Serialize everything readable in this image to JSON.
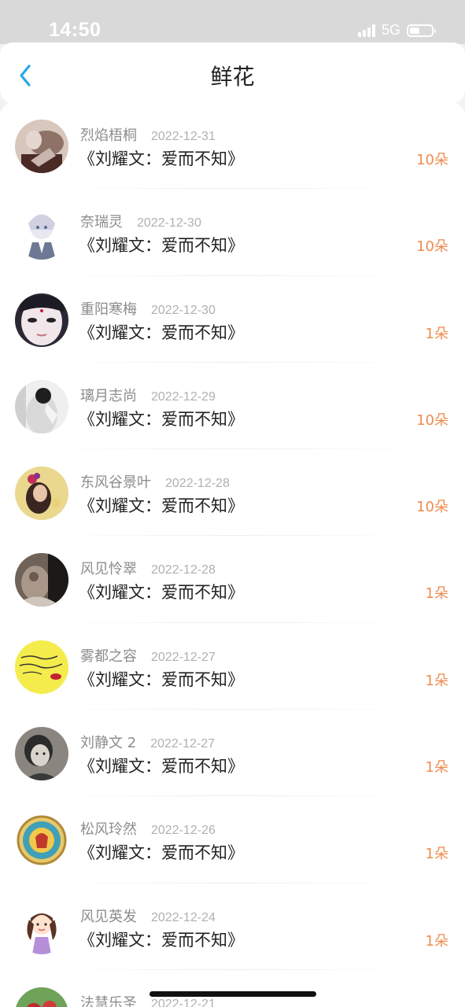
{
  "status_bar": {
    "time": "14:50",
    "network": "5G",
    "battery_level": 0.45
  },
  "header": {
    "back_icon": "chevron-left-icon",
    "title": "鲜花"
  },
  "colors": {
    "accent": "#2aa7e8",
    "count": "#ef8b4f",
    "name": "#8c8c8c",
    "date": "#b0b0b0"
  },
  "records": [
    {
      "user": "烈焰梧桐",
      "date": "2022-12-31",
      "book": "《刘耀文：爱而不知》",
      "count": "10朵",
      "avatar": "avatar-sepia"
    },
    {
      "user": "奈瑞灵",
      "date": "2022-12-30",
      "book": "《刘耀文：爱而不知》",
      "count": "10朵",
      "avatar": "avatar-anime"
    },
    {
      "user": "重阳寒梅",
      "date": "2022-12-30",
      "book": "《刘耀文：爱而不知》",
      "count": "1朵",
      "avatar": "avatar-face"
    },
    {
      "user": "璃月志尚",
      "date": "2022-12-29",
      "book": "《刘耀文：爱而不知》",
      "count": "10朵",
      "avatar": "avatar-mono"
    },
    {
      "user": "东风谷景叶",
      "date": "2022-12-28",
      "book": "《刘耀文：爱而不知》",
      "count": "10朵",
      "avatar": "avatar-flower"
    },
    {
      "user": "风见怜翠",
      "date": "2022-12-28",
      "book": "《刘耀文：爱而不知》",
      "count": "1朵",
      "avatar": "avatar-dark"
    },
    {
      "user": "雾都之容",
      "date": "2022-12-27",
      "book": "《刘耀文：爱而不知》",
      "count": "1朵",
      "avatar": "avatar-yellow"
    },
    {
      "user": "刘静文 2",
      "date": "2022-12-27",
      "book": "《刘耀文：爱而不知》",
      "count": "1朵",
      "avatar": "avatar-vintage"
    },
    {
      "user": "松风玲然",
      "date": "2022-12-26",
      "book": "《刘耀文：爱而不知》",
      "count": "1朵",
      "avatar": "avatar-emblem"
    },
    {
      "user": "风见英发",
      "date": "2022-12-24",
      "book": "《刘耀文：爱而不知》",
      "count": "1朵",
      "avatar": "avatar-cartoon"
    },
    {
      "user": "法慧乐圣",
      "date": "2022-12-21",
      "book": "",
      "count": "",
      "avatar": "avatar-red"
    }
  ]
}
